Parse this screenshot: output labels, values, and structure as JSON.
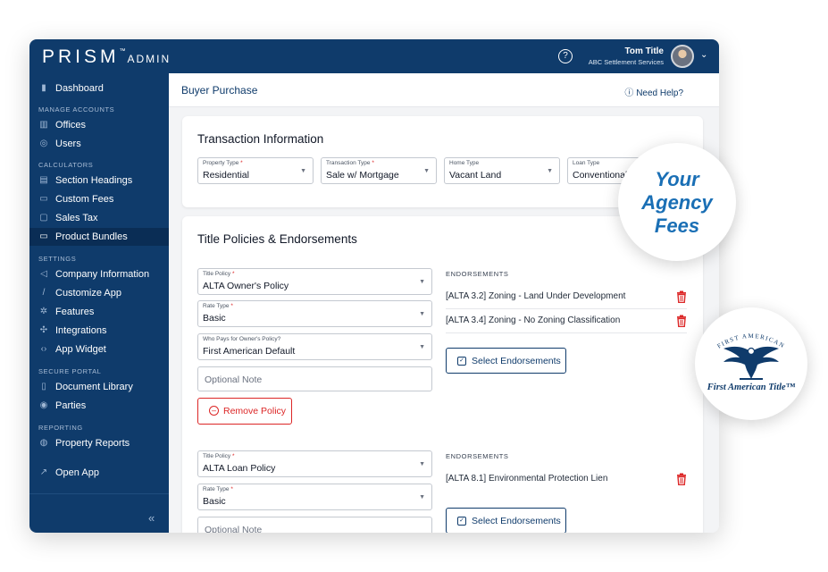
{
  "app": {
    "brand": "PRISM",
    "brand_tm": "™",
    "brand_suffix": "ADMIN"
  },
  "header": {
    "help_icon": "?",
    "user_name": "Tom Title",
    "user_org": "ABC Settlement Services",
    "caret": "⌄"
  },
  "sidebar": {
    "dashboard": "Dashboard",
    "section_manage": "MANAGE ACCOUNTS",
    "offices": "Offices",
    "users": "Users",
    "section_calculators": "CALCULATORS",
    "section_headings": "Section Headings",
    "custom_fees": "Custom Fees",
    "sales_tax": "Sales Tax",
    "product_bundles": "Product Bundles",
    "section_settings": "SETTINGS",
    "company_information": "Company Information",
    "customize_app": "Customize App",
    "features": "Features",
    "integrations": "Integrations",
    "app_widget": "App Widget",
    "section_portal": "SECURE PORTAL",
    "document_library": "Document Library",
    "parties": "Parties",
    "section_reporting": "REPORTING",
    "property_reports": "Property Reports",
    "open_app": "Open App",
    "collapse": "«"
  },
  "page": {
    "title": "Buyer Purchase",
    "need_help": "Need Help?"
  },
  "transaction": {
    "title": "Transaction Information",
    "property_type": {
      "label": "Property Type",
      "value": "Residential"
    },
    "transaction_type": {
      "label": "Transaction Type",
      "value": "Sale w/ Mortgage"
    },
    "home_type": {
      "label": "Home Type",
      "value": "Vacant Land"
    },
    "loan_type": {
      "label": "Loan Type",
      "value": "Conventional"
    },
    "required_mark": "*"
  },
  "policies": {
    "title": "Title Policies & Endorsements",
    "endorsements_heading": "ENDORSEMENTS",
    "select_endorsements": "Select Endorsements",
    "optional_note": "Optional Note",
    "remove_policy": "Remove Policy",
    "policy1": {
      "title_policy_label": "Title Policy",
      "title_policy_value": "ALTA Owner's Policy",
      "rate_type_label": "Rate Type",
      "rate_type_value": "Basic",
      "who_pays_label": "Who Pays for Owner's Policy?",
      "who_pays_value": "First American Default",
      "endorsements": [
        "[ALTA 3.2] Zoning - Land Under Development",
        "[ALTA 3.4] Zoning - No Zoning Classification"
      ]
    },
    "policy2": {
      "title_policy_label": "Title Policy",
      "title_policy_value": "ALTA Loan Policy",
      "rate_type_label": "Rate Type",
      "rate_type_value": "Basic",
      "endorsements": [
        "[ALTA 8.1] Environmental Protection Lien"
      ]
    }
  },
  "callouts": {
    "your": "Your",
    "agency": "Agency",
    "fees": "Fees",
    "logo_arc": "FIRST AMERICAN",
    "logo_text": "First American Title™"
  },
  "colors": {
    "navy": "#0f3b6b",
    "accent_blue": "#1a6fb5",
    "danger": "#dc2626"
  }
}
